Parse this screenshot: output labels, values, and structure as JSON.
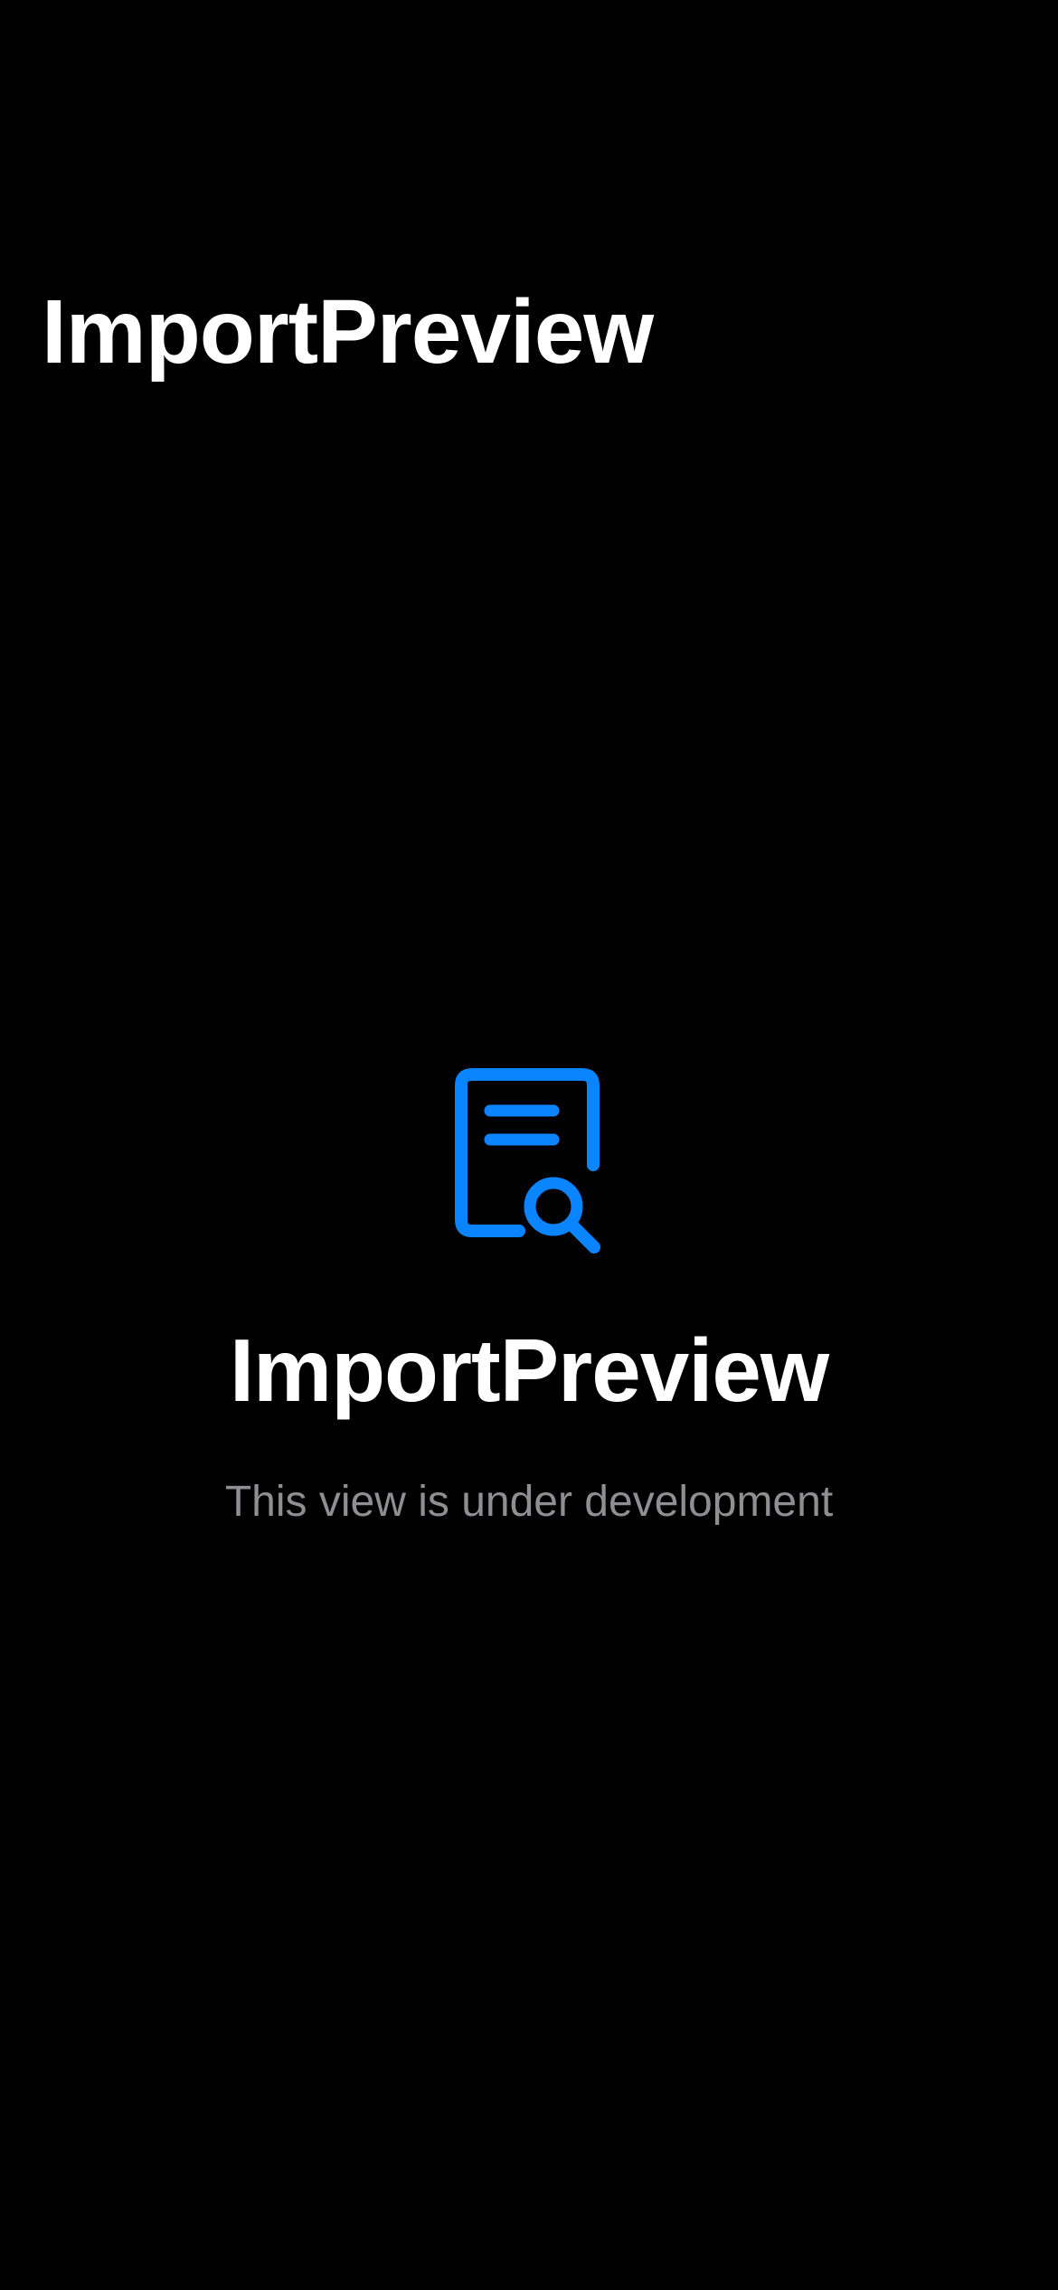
{
  "header": {
    "title": "ImportPreview"
  },
  "placeholder": {
    "icon": "doc-text-magnifyingglass-icon",
    "title": "ImportPreview",
    "subtitle": "This view is under development"
  },
  "colors": {
    "background": "#000000",
    "accent": "#0A84FF",
    "primary_text": "#FFFFFF",
    "secondary_text": "#8E8E93"
  }
}
